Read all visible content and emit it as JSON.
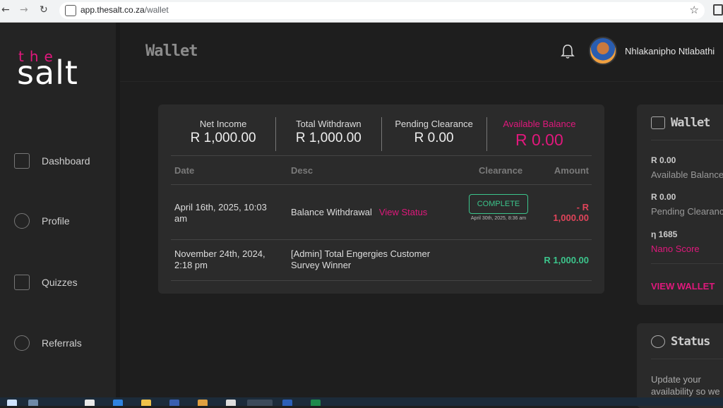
{
  "browser": {
    "url_host": "app.thesalt.co.za",
    "url_path": "/wallet"
  },
  "logo": {
    "top": "the",
    "bottom": "salt"
  },
  "sidebar": {
    "items": [
      {
        "label": "Dashboard",
        "icon": "dashboard-icon"
      },
      {
        "label": "Profile",
        "icon": "user-icon"
      },
      {
        "label": "Quizzes",
        "icon": "quiz-icon"
      },
      {
        "label": "Referrals",
        "icon": "referrals-icon"
      }
    ]
  },
  "header": {
    "title": "Wallet",
    "username": "Nhlakanipho Ntlabathi"
  },
  "stats": {
    "net_income_label": "Net Income",
    "net_income_value": "R 1,000.00",
    "total_withdrawn_label": "Total Withdrawn",
    "total_withdrawn_value": "R 1,000.00",
    "pending_label": "Pending Clearance",
    "pending_value": "R 0.00",
    "available_label": "Available Balance",
    "available_value": "R 0.00"
  },
  "table": {
    "headers": {
      "date": "Date",
      "desc": "Desc",
      "clearance": "Clearance",
      "amount": "Amount"
    },
    "rows": [
      {
        "date": "April 16th, 2025, 10:03 am",
        "desc": "Balance Withdrawal",
        "link": "View Status",
        "badge": "COMPLETE",
        "badge_date": "April 30th, 2025, 8:36 am",
        "amount_line1": "- R",
        "amount_line2": "1,000.00"
      },
      {
        "date": "November 24th, 2024, 2:18 pm",
        "desc": "[Admin] Total Engergies Customer Survey Winner",
        "amount": "R 1,000.00"
      }
    ]
  },
  "wallet_card": {
    "title": "Wallet",
    "available_amount": "R 0.00",
    "available_label": "Available Balance",
    "pending_amount": "R 0.00",
    "pending_label": "Pending Clearance",
    "nano_amount": "η 1685",
    "nano_label": "Nano Score",
    "link": "VIEW WALLET"
  },
  "status_card": {
    "title": "Status",
    "text_line1": "Update your",
    "text_line2": "availability so we"
  },
  "colors": {
    "accent": "#e0187c",
    "success": "#3cc58c",
    "negative": "#e0445a",
    "background": "#1e1e1e",
    "card": "#2b2b2b"
  }
}
